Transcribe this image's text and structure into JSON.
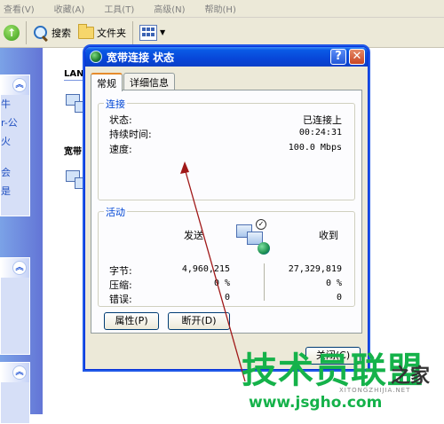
{
  "explorer": {
    "menu": [
      "查看(V)",
      "收藏(A)",
      "工具(T)",
      "高级(N)",
      "帮助(H)"
    ],
    "toolbar": {
      "search_label": "搜索",
      "folders_label": "文件夹"
    },
    "left_pane": {
      "links": [
        "牛",
        "r-公",
        "火",
        "会",
        "是"
      ]
    },
    "content": {
      "section_lan": "LAN",
      "section_broadband": "宽带"
    }
  },
  "dialog": {
    "title": "宽带连接 状态",
    "tabs": [
      "常规",
      "详细信息"
    ],
    "connection": {
      "legend": "连接",
      "status_label": "状态:",
      "status_value": "已连接上",
      "duration_label": "持续时间:",
      "duration_value": "00:24:31",
      "speed_label": "速度:",
      "speed_value": "100.0 Mbps"
    },
    "activity": {
      "legend": "活动",
      "sent_label": "发送",
      "received_label": "收到",
      "rows": [
        {
          "label": "字节:",
          "sent": "4,960,215",
          "received": "27,329,819"
        },
        {
          "label": "压缩:",
          "sent": "0 %",
          "received": "0 %"
        },
        {
          "label": "错误:",
          "sent": "0",
          "received": "0"
        }
      ]
    },
    "buttons": {
      "properties": "属性(P)",
      "disconnect": "断开(D)",
      "close": "关闭(C)"
    }
  },
  "watermark": {
    "brand": "技术员联盟",
    "suffix": "之家",
    "romanized": "XITONGZHIJIA.NET",
    "url": "www.jsgho.com"
  },
  "colors": {
    "title_bar": "#0846d8",
    "group_legend": "#0046d5",
    "annotation_arrow": "#a01818",
    "watermark_green": "#15b24a"
  }
}
